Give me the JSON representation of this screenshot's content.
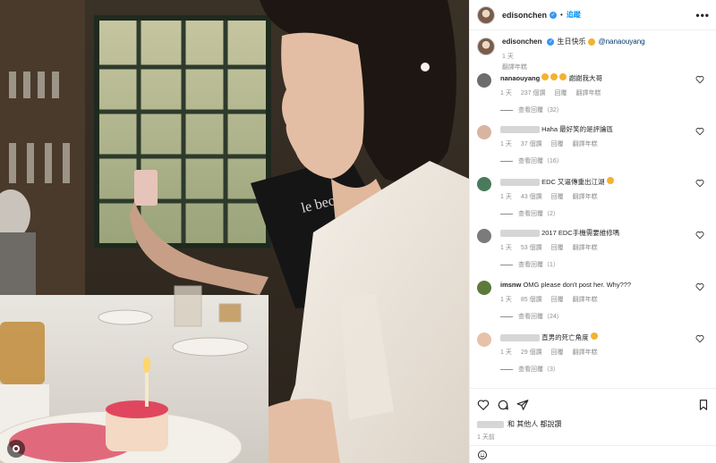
{
  "photo": {
    "menu_label": "le bec"
  },
  "header": {
    "username": "edisonchen",
    "follow_label": "追蹤",
    "more_label": "•••"
  },
  "caption": {
    "username": "edisonchen",
    "text": "生日快乐",
    "mention": "@nanaouyang",
    "time": "1 天",
    "translate": "翻譯年糕"
  },
  "comments": [
    {
      "username": "nanaouyang",
      "text": "謝謝我大哥",
      "time": "1 天",
      "likes": "237 個讚",
      "reply": "回覆",
      "translate": "翻譯年糕",
      "view_replies": "查看回覆（32）",
      "avatar_color": "#6d6d6d"
    },
    {
      "username": "",
      "text": "Haha 最好笑的是評論區",
      "time": "1 天",
      "likes": "37 個讚",
      "reply": "回覆",
      "translate": "翻譯年糕",
      "view_replies": "查看回覆（16）",
      "avatar_color": "#d9b4a0"
    },
    {
      "username": "",
      "text": "EDC 又逼傳重出江湖",
      "time": "1 天",
      "likes": "43 個讚",
      "reply": "回覆",
      "translate": "翻譯年糕",
      "view_replies": "查看回覆（2）",
      "avatar_color": "#4a7a5a"
    },
    {
      "username": "",
      "text": "2017 EDC手機需要維修嗎",
      "time": "1 天",
      "likes": "53 個讚",
      "reply": "回覆",
      "translate": "翻譯年糕",
      "view_replies": "查看回覆（1）",
      "avatar_color": "#7b7b7b"
    },
    {
      "username": "imsnw",
      "text": "OMG please don't post her. Why???",
      "time": "1 天",
      "likes": "85 個讚",
      "reply": "回覆",
      "translate": "翻譯年糕",
      "view_replies": "查看回覆（24）",
      "avatar_color": "#5c7a3b"
    },
    {
      "username": "",
      "text": "直男的死亡角度",
      "time": "1 天",
      "likes": "29 個讚",
      "reply": "回覆",
      "translate": "翻譯年糕",
      "view_replies": "查看回覆（3）",
      "avatar_color": "#e6c2a8"
    }
  ],
  "actions": {
    "likes_suffix": "和 其他人 都說讚",
    "timestamp": "1 天前",
    "add_comment_placeholder": "",
    "post_label": ""
  }
}
